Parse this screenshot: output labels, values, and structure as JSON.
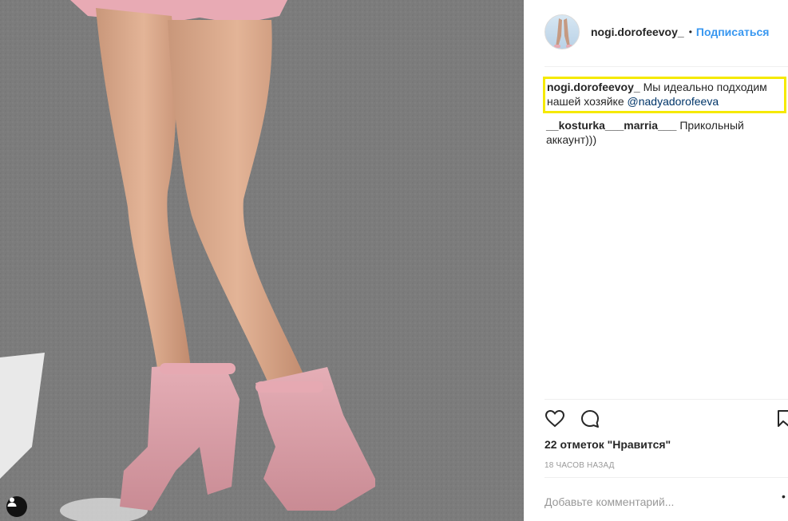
{
  "post": {
    "username": "nogi.dorofeevoy_",
    "dot": "•",
    "follow_label": "Подписаться",
    "caption": {
      "username": "nogi.dorofeevoy_",
      "text": " Мы идеально подходим нашей хозяйке ",
      "mention": "@nadyadorofeeva"
    },
    "comments": [
      {
        "username": "__kosturka___marria___",
        "text": " Прикольный аккаунт)))"
      }
    ],
    "likes_text": "22 отметок \"Нравится\"",
    "timestamp": "18 часов назад",
    "add_comment_placeholder": "Добавьте комментарий...",
    "more_label": "•"
  },
  "colors": {
    "link": "#3897f0",
    "mention": "#003569",
    "highlight": "#f5e900"
  },
  "icons": [
    "heart-icon",
    "comment-icon",
    "bookmark-icon",
    "tag-people-icon"
  ]
}
